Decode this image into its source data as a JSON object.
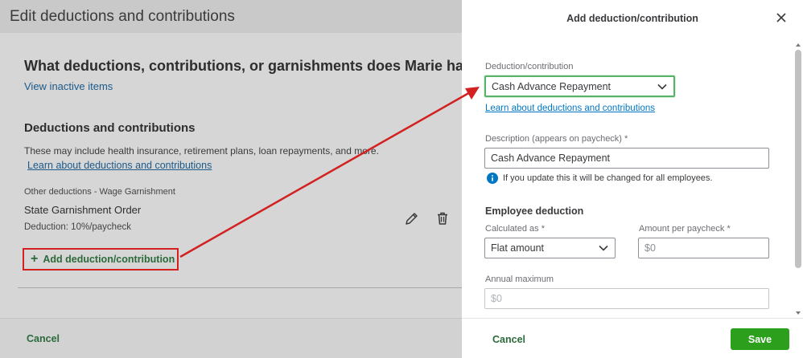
{
  "left_page": {
    "title": "Edit deductions and contributions",
    "question": "What deductions, contributions, or garnishments does Marie have?",
    "view_inactive_label": "View inactive items",
    "section_heading": "Deductions and contributions",
    "section_description": "These may include health insurance, retirement plans, loan repayments, and more.",
    "learn_link": "Learn about deductions and contributions",
    "item": {
      "category": "Other deductions - Wage Garnishment",
      "name": "State Garnishment Order",
      "detail": "Deduction: 10%/paycheck"
    },
    "add_button_label": "Add deduction/contribution",
    "add_button_plus": "+",
    "footer_cancel": "Cancel"
  },
  "drawer": {
    "title": "Add deduction/contribution",
    "deduction_label": "Deduction/contribution",
    "deduction_value": "Cash Advance Repayment",
    "learn_link": "Learn about deductions and contributions",
    "description_label": "Description (appears on paycheck) *",
    "description_value": "Cash Advance Repayment",
    "info_text": "If you update this it will be changed for all employees.",
    "employee_deduction_heading": "Employee deduction",
    "calculated_as_label": "Calculated as *",
    "calculated_as_value": "Flat amount",
    "amount_label": "Amount per paycheck *",
    "amount_placeholder": "$0",
    "annual_max_label": "Annual maximum",
    "annual_max_placeholder": "$0",
    "footer_cancel": "Cancel",
    "save_label": "Save"
  },
  "colors": {
    "accent_green": "#2ca01c",
    "link_blue": "#0077c5",
    "annotation_red": "#d32020",
    "active_border": "#58b368"
  },
  "icons": [
    "pencil-icon",
    "trash-icon",
    "close-icon",
    "chevron-down-icon",
    "info-icon"
  ]
}
